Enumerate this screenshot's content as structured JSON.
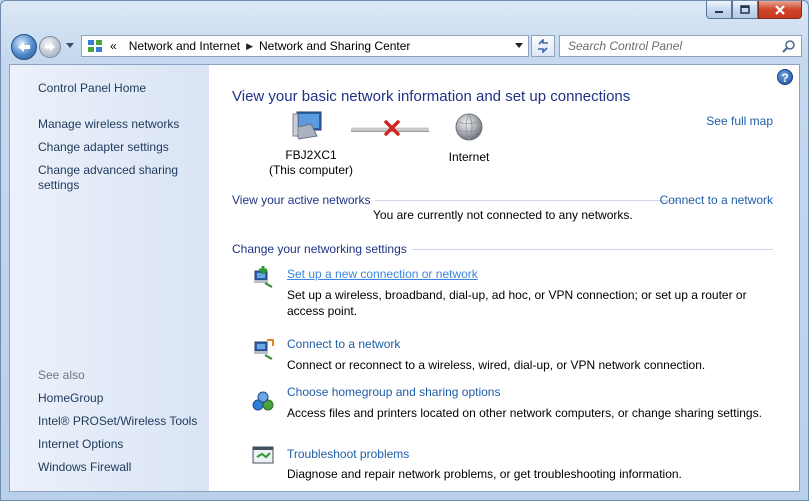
{
  "window": {
    "colors": {
      "accent": "#1e3287",
      "link": "#1e5ea8",
      "close": "#c4381f",
      "sidebar_text": "#1e395b"
    }
  },
  "nav": {
    "breadcrumb": [
      "Network and Internet",
      "Network and Sharing Center"
    ],
    "overflow_glyph": "«",
    "search_placeholder": "Search Control Panel"
  },
  "sidebar": {
    "home": "Control Panel Home",
    "links": [
      "Manage wireless networks",
      "Change adapter settings",
      "Change advanced sharing settings"
    ],
    "see_also_label": "See also",
    "see_also": [
      "HomeGroup",
      "Intel® PROSet/Wireless Tools",
      "Internet Options",
      "Windows Firewall"
    ]
  },
  "main": {
    "help": "?",
    "title": "View your basic network information and set up connections",
    "see_full_map": "See full map",
    "computer_name": "FBJ2XC1",
    "computer_sub": "(This computer)",
    "internet_label": "Internet",
    "active_networks_label": "View your active networks",
    "connect_link": "Connect to a network",
    "not_connected": "You are currently not connected to any networks.",
    "change_settings_label": "Change your networking settings",
    "tasks": [
      {
        "icon": "new-connection-icon",
        "title": "Set up a new connection or network",
        "desc": "Set up a wireless, broadband, dial-up, ad hoc, or VPN connection; or set up a router or access point."
      },
      {
        "icon": "connect-network-icon",
        "title": "Connect to a network",
        "desc": "Connect or reconnect to a wireless, wired, dial-up, or VPN network connection."
      },
      {
        "icon": "homegroup-icon",
        "title": "Choose homegroup and sharing options",
        "desc": "Access files and printers located on other network computers, or change sharing settings."
      },
      {
        "icon": "troubleshoot-icon",
        "title": "Troubleshoot problems",
        "desc": "Diagnose and repair network problems, or get troubleshooting information."
      }
    ]
  }
}
